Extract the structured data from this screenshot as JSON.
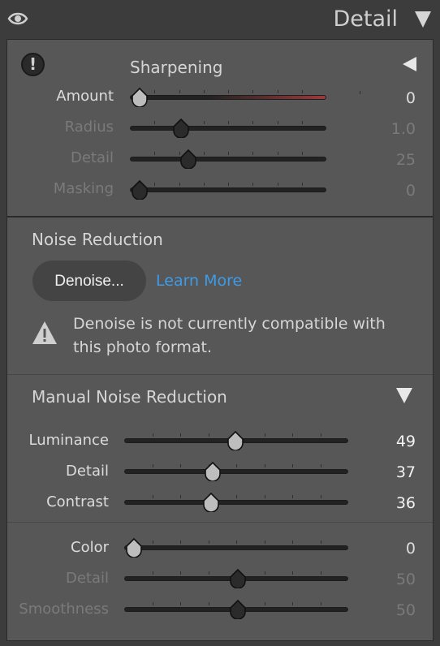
{
  "header": {
    "title": "Detail"
  },
  "sharpening": {
    "title": "Sharpening",
    "sliders": [
      {
        "label": "Amount",
        "value": "0",
        "fraction": 0.0,
        "active": true
      },
      {
        "label": "Radius",
        "value": "1.0",
        "fraction": 0.23,
        "active": false
      },
      {
        "label": "Detail",
        "value": "25",
        "fraction": 0.27,
        "active": false
      },
      {
        "label": "Masking",
        "value": "0",
        "fraction": 0.0,
        "active": false
      }
    ]
  },
  "noise_reduction": {
    "title": "Noise Reduction",
    "denoise_label": "Denoise...",
    "learn_more": "Learn More",
    "warning": "Denoise is not currently compatible with this photo format."
  },
  "manual_noise": {
    "title": "Manual Noise Reduction",
    "luma_sliders": [
      {
        "label": "Luminance",
        "value": "49",
        "fraction": 0.49
      },
      {
        "label": "Detail",
        "value": "37",
        "fraction": 0.38
      },
      {
        "label": "Contrast",
        "value": "36",
        "fraction": 0.37
      }
    ],
    "color_sliders": [
      {
        "label": "Color",
        "value": "0",
        "fraction": 0.0,
        "active": true
      },
      {
        "label": "Detail",
        "value": "50",
        "fraction": 0.5,
        "active": false
      },
      {
        "label": "Smoothness",
        "value": "50",
        "fraction": 0.5,
        "active": false
      }
    ]
  },
  "colors": {
    "accent_link": "#3e9be6",
    "panel": "#575757",
    "header": "#3c3c3c"
  }
}
